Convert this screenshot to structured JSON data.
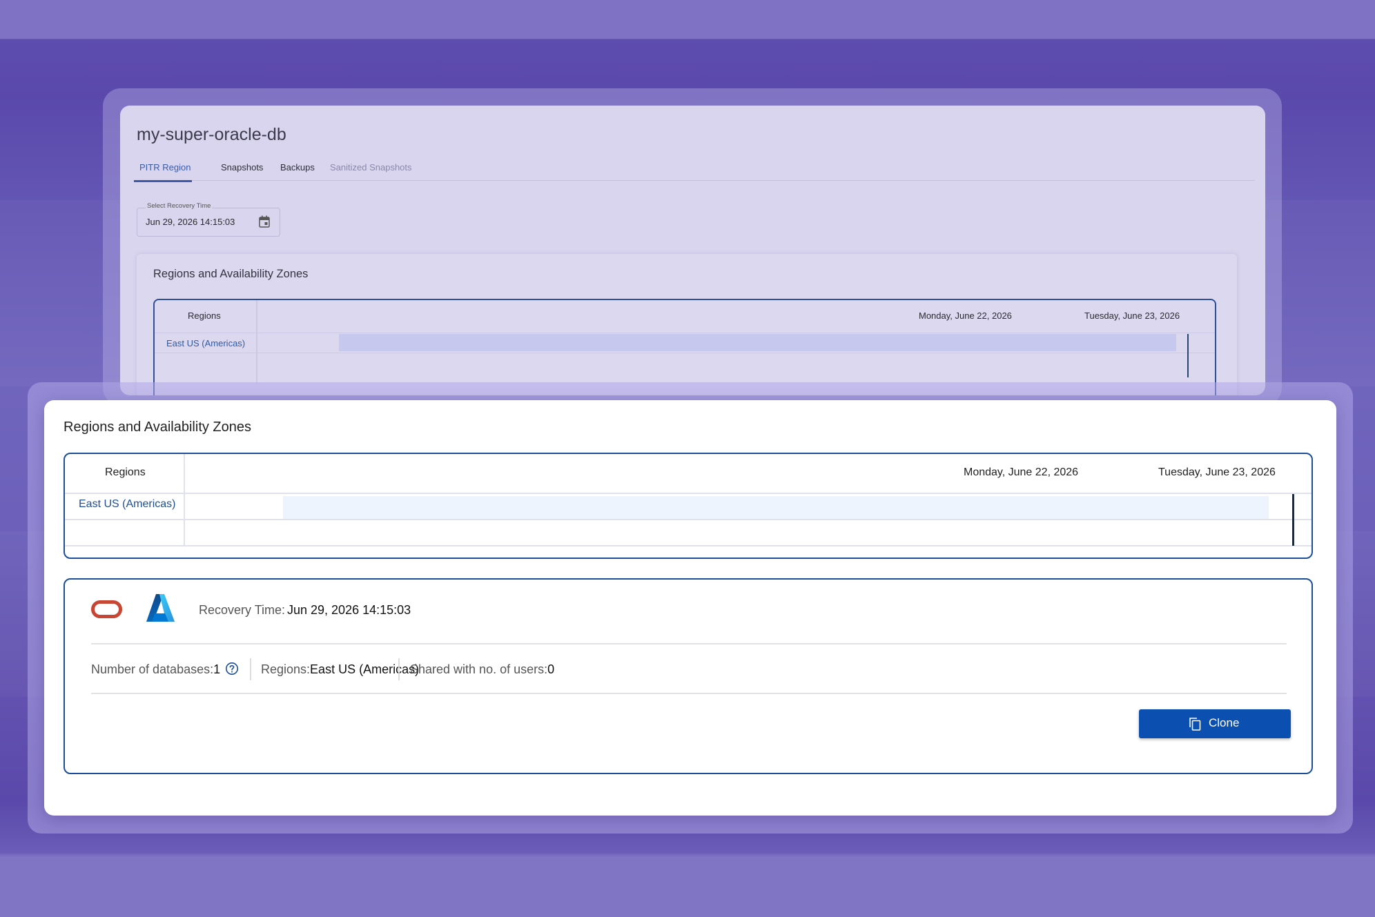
{
  "back_window": {
    "title": "my-super-oracle-db",
    "tabs": [
      {
        "label": "PITR Region",
        "active": true
      },
      {
        "label": "Snapshots",
        "active": false
      },
      {
        "label": "Backups",
        "active": false
      },
      {
        "label": "Sanitized Snapshots",
        "disabled": true
      }
    ],
    "recovery_field": {
      "label": "Select Recovery Time",
      "value": "Jun 29, 2026 14:15:03",
      "icon": "calendar-icon"
    },
    "section_title": "Regions and Availability Zones",
    "table": {
      "header_regions": "Regions",
      "dates": [
        "Monday, June 22, 2026",
        "Tuesday, June 23, 2026"
      ],
      "rows": [
        {
          "region": "East US (Americas)"
        }
      ]
    }
  },
  "front_window": {
    "section_title": "Regions and Availability Zones",
    "table": {
      "header_regions": "Regions",
      "dates": [
        "Monday, June 22, 2026",
        "Tuesday, June 23, 2026"
      ],
      "rows": [
        {
          "region": "East US (Americas)"
        }
      ]
    },
    "detail": {
      "logos": [
        "oracle-logo",
        "azure-logo"
      ],
      "recovery_time_label": "Recovery Time:",
      "recovery_time_value": "Jun 29, 2026 14:15:03",
      "stats": [
        {
          "label": "Number of databases:",
          "value": "1",
          "icon": "help-circle-icon"
        },
        {
          "label": "Regions:",
          "value": "East US (Americas)"
        },
        {
          "label": "Shared with no. of users:",
          "value": "0"
        }
      ],
      "clone_button": {
        "label": "Clone",
        "icon": "copy-icon"
      }
    }
  },
  "colors": {
    "background": "#5a4aa9",
    "accent_blue": "#1b4d9a",
    "button_blue": "#0b4fb0",
    "oracle_red": "#c74634",
    "azure_blue": "#0078d4"
  }
}
